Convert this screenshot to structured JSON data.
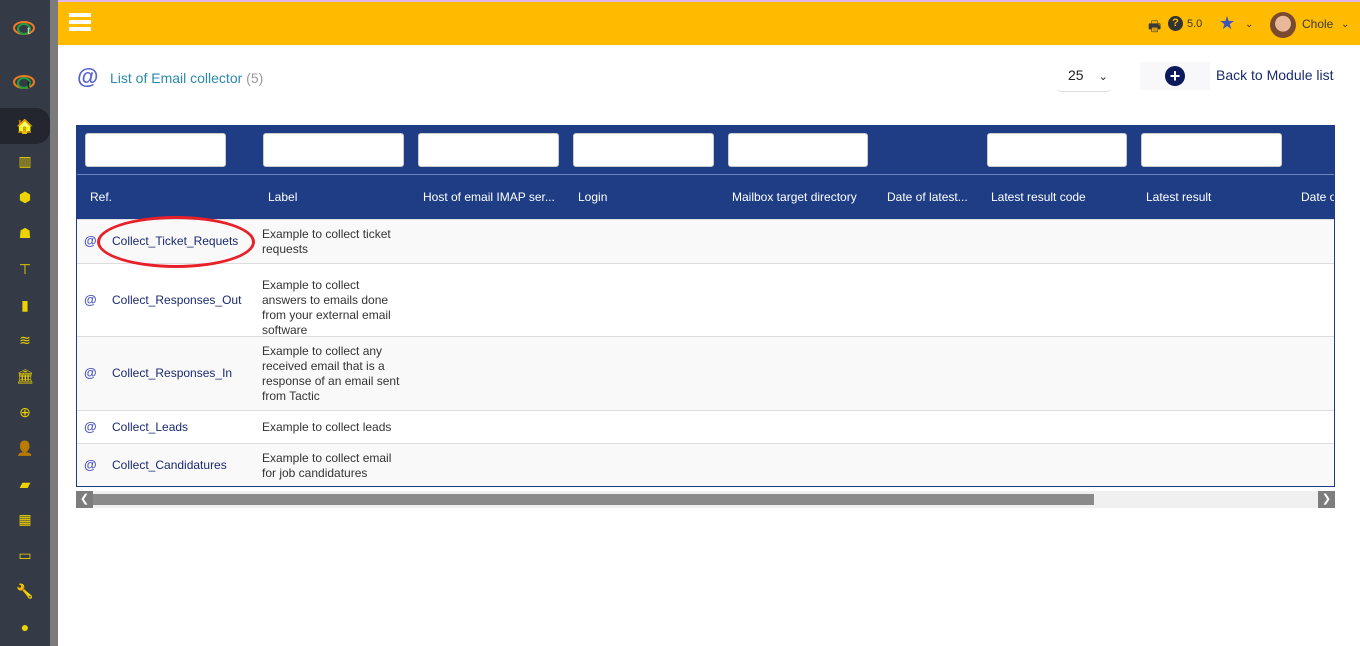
{
  "app": {
    "version": "5.0",
    "user": "Chole"
  },
  "sidebar": {
    "items": [
      {
        "icon": "home-icon"
      },
      {
        "icon": "building-icon"
      },
      {
        "icon": "box-icon"
      },
      {
        "icon": "boxes-icon"
      },
      {
        "icon": "sitemap-icon"
      },
      {
        "icon": "briefcase-icon"
      },
      {
        "icon": "coins-icon"
      },
      {
        "icon": "bank-icon"
      },
      {
        "icon": "search-dollar-icon"
      },
      {
        "icon": "user-tie-icon"
      },
      {
        "icon": "folder-open-icon"
      },
      {
        "icon": "calendar-icon"
      },
      {
        "icon": "ticket-icon"
      },
      {
        "icon": "wrench-icon"
      },
      {
        "icon": "globe-icon"
      }
    ]
  },
  "page": {
    "title": "List of Email collector",
    "count": "(5)",
    "page_size": "25",
    "back_label": "Back to Module list"
  },
  "table": {
    "columns": [
      "Ref.",
      "Label",
      "Host of email IMAP ser...",
      "Login",
      "Mailbox target directory",
      "Date of latest...",
      "Latest result code",
      "Latest result",
      "Date o"
    ],
    "rows": [
      {
        "ref": "Collect_Ticket_Requets",
        "label": "Example to collect ticket requests"
      },
      {
        "ref": "Collect_Responses_Out",
        "label": "Example to collect answers to emails done from your external email software"
      },
      {
        "ref": "Collect_Responses_In",
        "label": "Example to collect any received email that is a response of an email sent from Tactic"
      },
      {
        "ref": "Collect_Leads",
        "label": "Example to collect leads"
      },
      {
        "ref": "Collect_Candidatures",
        "label": "Example to collect email for job candidatures"
      }
    ]
  },
  "colors": {
    "topbar": "#ffbb00",
    "sidebar": "#353a47",
    "table_header": "#1e3d85",
    "icons": "#ffb800",
    "highlight": "#e8202a"
  }
}
